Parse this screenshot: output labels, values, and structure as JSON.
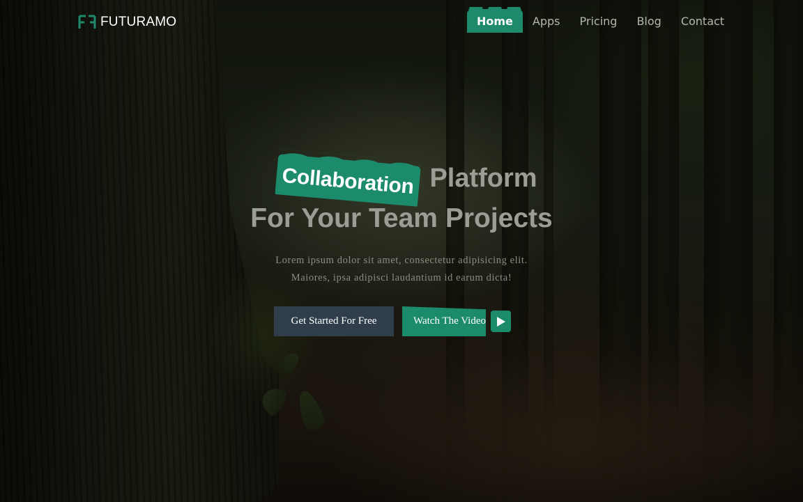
{
  "brand": {
    "name": "FUTURAMO",
    "accent_color": "#1e8a6c"
  },
  "nav": {
    "items": [
      {
        "label": "Home",
        "active": true
      },
      {
        "label": "Apps",
        "active": false
      },
      {
        "label": "Pricing",
        "active": false
      },
      {
        "label": "Blog",
        "active": false
      },
      {
        "label": "Contact",
        "active": false
      }
    ]
  },
  "hero": {
    "highlight": "Collaboration",
    "title_rest": "Platform",
    "title_line2": "For Your Team Projects",
    "subtitle_line1": "Lorem ipsum dolor sit amet, consectetur adipisicing elit.",
    "subtitle_line2": "Maiores, ipsa adipisci laudantium id earum dicta!",
    "primary_button": "Get Started For Free",
    "video_button": "Watch The Video",
    "primary_button_color": "#2f3e4a"
  },
  "icons": {
    "logo": "ff-logo-icon",
    "play": "play-icon"
  }
}
